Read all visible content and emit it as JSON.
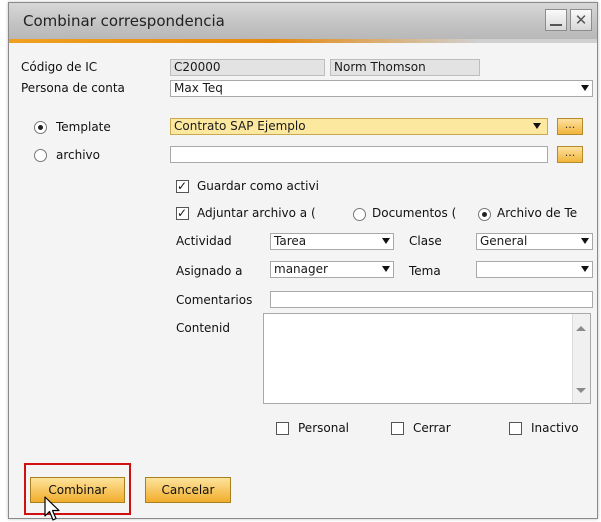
{
  "window": {
    "title": "Combinar correspondencia",
    "minimize_label": "_",
    "close_label": "✕"
  },
  "form": {
    "codigo_label": "Código de IC",
    "codigo_value": "C20000",
    "codigo_name": "Norm Thomson",
    "persona_label": "Persona de conta",
    "persona_value": "Max Teq",
    "template_label": "Template",
    "template_value": "Contrato SAP Ejemplo",
    "archivo_label": "archivo",
    "archivo_value": "",
    "browse_label": "...",
    "guardar_label": "Guardar como activi",
    "adjuntar_label": "Adjuntar archivo a (",
    "documentos_label": "Documentos (",
    "archivo_de_label": "Archivo de Te",
    "actividad_label": "Actividad",
    "actividad_value": "Tarea",
    "clase_label": "Clase",
    "clase_value": "General",
    "asignado_label": "Asignado a",
    "asignado_value": "manager",
    "tema_label": "Tema",
    "tema_value": "",
    "comentarios_label": "Comentarios",
    "comentarios_value": "",
    "contenido_label": "Contenid",
    "personal_label": "Personal",
    "cerrar_label": "Cerrar",
    "inactivo_label": "Inactivo"
  },
  "buttons": {
    "combinar": "Combinar",
    "cancelar": "Cancelar"
  },
  "state": {
    "template_selected": true,
    "guardar_checked": true,
    "adjuntar_checked": true,
    "adjuntar_target": "Archivo de Te",
    "personal_checked": false,
    "cerrar_checked": false,
    "inactivo_checked": false
  },
  "colors": {
    "accent": "#f0a020",
    "highlight_field": "#fde8a0",
    "button": "#f2ad2c",
    "focus_box": "#d01010"
  }
}
